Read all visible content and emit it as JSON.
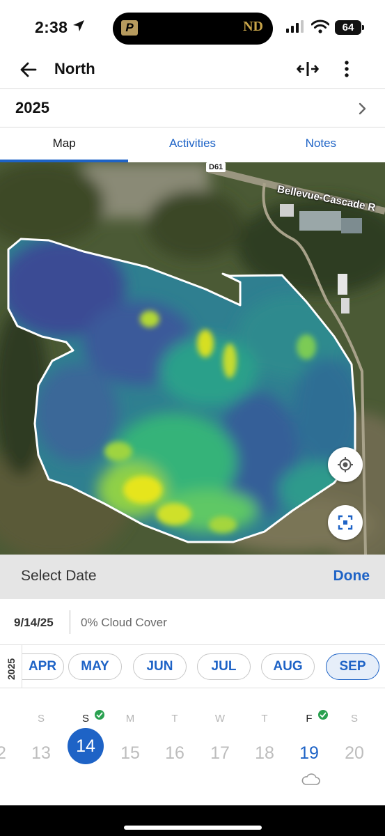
{
  "status_bar": {
    "time": "2:38",
    "battery": "64",
    "island_left_logo": "P",
    "island_right_logo": "ND"
  },
  "header": {
    "title": "North",
    "icons": [
      "back-arrow-icon",
      "split-view-icon",
      "more-vertical-icon"
    ]
  },
  "season": {
    "year": "2025"
  },
  "tabs": [
    {
      "label": "Map",
      "active": true
    },
    {
      "label": "Activities",
      "active": false
    },
    {
      "label": "Notes",
      "active": false
    }
  ],
  "map": {
    "road_number": "D61",
    "road_name": "Bellevue-Cascade R",
    "controls": [
      "locate-icon",
      "fit-bounds-icon"
    ]
  },
  "date_picker": {
    "title": "Select Date",
    "done_label": "Done",
    "selected_date": "9/14/25",
    "cloud_cover": "0% Cloud Cover",
    "year_label": "2025",
    "months": [
      {
        "label": "APR",
        "active": false
      },
      {
        "label": "MAY",
        "active": false
      },
      {
        "label": "JUN",
        "active": false
      },
      {
        "label": "JUL",
        "active": false
      },
      {
        "label": "AUG",
        "active": false
      },
      {
        "label": "SEP",
        "active": true
      }
    ],
    "days": [
      {
        "dow": "",
        "num": "2",
        "state": "disabled"
      },
      {
        "dow": "S",
        "num": "13",
        "state": "disabled"
      },
      {
        "dow": "S",
        "num": "14",
        "state": "selected",
        "has_image": true
      },
      {
        "dow": "M",
        "num": "15",
        "state": "disabled"
      },
      {
        "dow": "T",
        "num": "16",
        "state": "disabled"
      },
      {
        "dow": "W",
        "num": "17",
        "state": "disabled"
      },
      {
        "dow": "T",
        "num": "18",
        "state": "disabled"
      },
      {
        "dow": "F",
        "num": "19",
        "state": "available",
        "has_image": true,
        "weather": "cloud-icon"
      },
      {
        "dow": "S",
        "num": "20",
        "state": "disabled"
      }
    ]
  },
  "colors": {
    "accent": "#1e63c6",
    "check": "#2aa150",
    "panel_bg": "#e5e5e5"
  }
}
